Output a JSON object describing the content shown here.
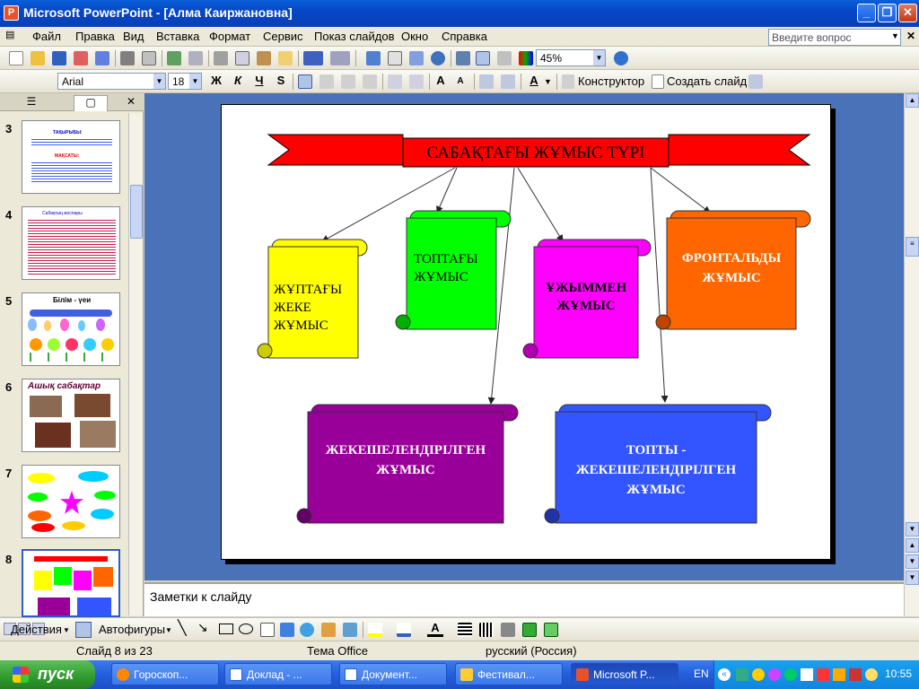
{
  "window": {
    "title": "Microsoft PowerPoint - [Алма Каиржановна]",
    "app_icon_letter": "P"
  },
  "menu": {
    "items": [
      "Файл",
      "Правка",
      "Вид",
      "Вставка",
      "Формат",
      "Сервис",
      "Показ слайдов",
      "Окно",
      "Справка"
    ],
    "ask_placeholder": "Введите вопрос"
  },
  "standard_toolbar": {
    "zoom": "45%"
  },
  "format_toolbar": {
    "font": "Arial",
    "size": "18",
    "bold": "Ж",
    "italic": "К",
    "underline": "Ч",
    "shadow": "S",
    "designer": "Конструктор",
    "new_slide": "Создать слайд"
  },
  "slide_panel": {
    "thumbnails": [
      {
        "number": "3",
        "texts": [
          "ТАҚЫРЫБЫ:",
          "МАҚСАТЫ:"
        ]
      },
      {
        "number": "4",
        "texts": [
          "Сабақтың жоспары"
        ]
      },
      {
        "number": "5",
        "texts": [
          "Білім - үеи"
        ]
      },
      {
        "number": "6",
        "texts": [
          "Ашық сабақтар"
        ]
      },
      {
        "number": "7",
        "texts": []
      },
      {
        "number": "8",
        "texts": []
      }
    ]
  },
  "slide": {
    "title": "САБАҚТАҒЫ ЖҰМЫС ТҮРІ",
    "boxes": [
      {
        "id": "pair",
        "text_lines": [
          "ЖҰПТАҒЫ",
          "ЖЕКЕ",
          "ЖҰМЫС"
        ],
        "color": "#ffff00"
      },
      {
        "id": "group",
        "text_lines": [
          "ТОПТАҒЫ",
          "ЖҰМЫС"
        ],
        "color": "#00ff00"
      },
      {
        "id": "team",
        "text_lines": [
          "ҰЖЫММЕН",
          "ЖҰМЫС"
        ],
        "color": "#ff00ff"
      },
      {
        "id": "frontal",
        "text_lines": [
          "ФРОНТАЛЬДЫ",
          "ЖҰМЫС"
        ],
        "color": "#ff6600"
      },
      {
        "id": "individual",
        "text_lines": [
          "ЖЕКЕШЕЛЕНДІРІЛГЕН",
          "ЖҰМЫС"
        ],
        "color": "#990099"
      },
      {
        "id": "group-individual",
        "text_lines": [
          "ТОПТЫ -",
          "ЖЕКЕШЕЛЕНДІРІЛГЕН",
          "ЖҰМЫС"
        ],
        "color": "#3355ff"
      }
    ],
    "banner_color": "#ff0000"
  },
  "notes": {
    "placeholder": "Заметки к слайду"
  },
  "draw_toolbar": {
    "actions": "Действия",
    "autoshapes": "Автофигуры"
  },
  "status": {
    "slide": "Слайд 8 из 23",
    "theme": "Тема Office",
    "language": "русский (Россия)"
  },
  "taskbar": {
    "start": "пуск",
    "buttons": [
      "Гороскоп...",
      "Доклад - ...",
      "Документ...",
      "Фестивал...",
      "Microsoft P..."
    ],
    "lang": "EN",
    "clock": "10:55"
  }
}
